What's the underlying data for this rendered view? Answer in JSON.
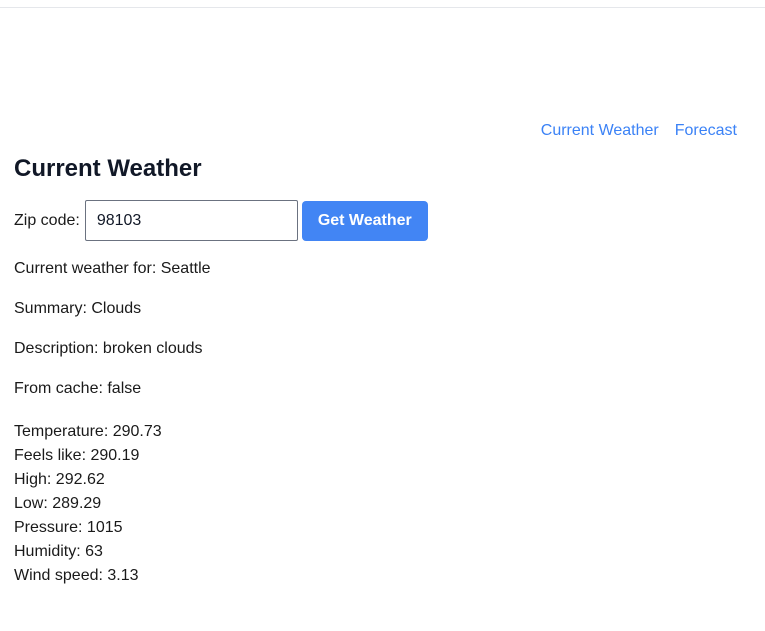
{
  "nav": {
    "current_weather": "Current Weather",
    "forecast": "Forecast"
  },
  "page": {
    "title": "Current Weather"
  },
  "form": {
    "zip_label": "Zip code:",
    "zip_value": "98103",
    "submit_label": "Get Weather"
  },
  "result": {
    "location": "Current weather for: Seattle",
    "summary": "Summary: Clouds",
    "description": "Description: broken clouds",
    "from_cache": "From cache: false",
    "temperature": "Temperature: 290.73",
    "feels_like": "Feels like: 290.19",
    "high": "High: 292.62",
    "low": "Low: 289.29",
    "pressure": "Pressure: 1015",
    "humidity": "Humidity: 63",
    "wind_speed": "Wind speed: 3.13"
  },
  "colors": {
    "link": "#3b82f6",
    "button": "#4285f4"
  }
}
